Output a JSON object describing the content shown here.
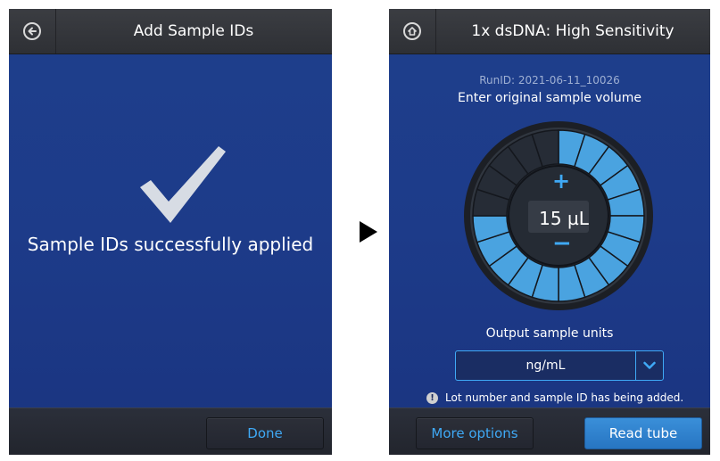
{
  "left_screen": {
    "title": "Add Sample IDs",
    "back_icon": "arrow-left-circle-icon",
    "message": "Sample IDs successfully applied",
    "check_icon": "checkmark-icon",
    "done_label": "Done"
  },
  "right_screen": {
    "title": "1x dsDNA: High Sensitivity",
    "home_icon": "home-circle-icon",
    "run_id": "RunID: 2021-06-11_10026",
    "prompt": "Enter original sample volume",
    "volume_display": "15 µL",
    "dial": {
      "total_segments": 20,
      "filled_segments": 15
    },
    "plus_label": "+",
    "minus_label": "−",
    "units_label": "Output sample units",
    "units_value": "ng/mL",
    "notice_icon_label": "!",
    "notice": "Lot number and sample ID has being added.",
    "more_options_label": "More options",
    "read_tube_label": "Read tube"
  },
  "colors": {
    "accent": "#3fa9f5",
    "screen_bg": "#1d3b89",
    "segment_filled": "#4aa3e0",
    "segment_empty": "#262c36"
  }
}
